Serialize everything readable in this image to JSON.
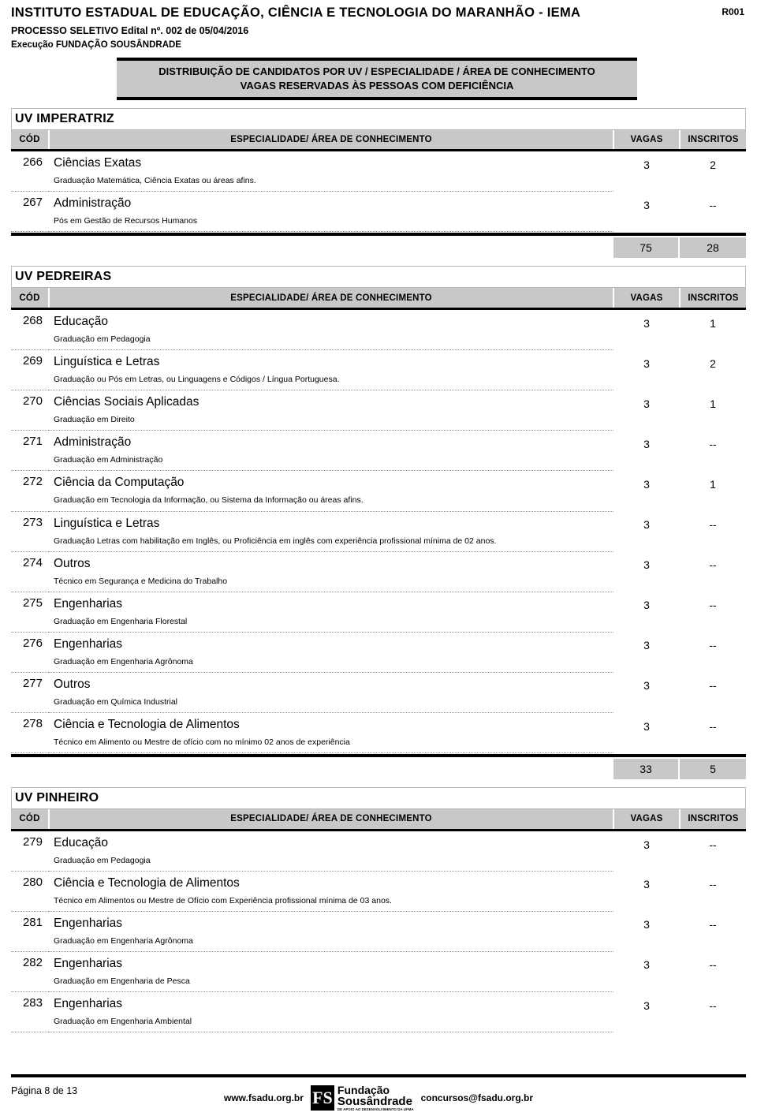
{
  "header": {
    "org_title": "INSTITUTO ESTADUAL DE EDUCAÇÃO, CIÊNCIA E TECNOLOGIA DO MARANHÃO - IEMA",
    "edital_line": "PROCESSO SELETIVO Edital nº. 002 de 05/04/2016",
    "exec_line": "Execução FUNDAÇÃO SOUSÂNDRADE",
    "report_code": "R001"
  },
  "title_box": {
    "line1": "DISTRIBUIÇÃO DE CANDIDATOS POR UV / ESPECIALIDADE / ÁREA DE CONHECIMENTO",
    "line2": "VAGAS RESERVADAS ÀS PESSOAS COM DEFICIÊNCIA"
  },
  "columns": {
    "cod": "CÓD",
    "spec": "ESPECIALIDADE/ ÁREA DE CONHECIMENTO",
    "vagas": "VAGAS",
    "inscritos": "INSCRITOS"
  },
  "groups": [
    {
      "name": "UV IMPERATRIZ",
      "rows": [
        {
          "cod": "266",
          "spec": "Ciências Exatas",
          "desc": "Graduação Matemática, Ciência Exatas ou áreas afins.",
          "vagas": "3",
          "inscritos": "2"
        },
        {
          "cod": "267",
          "spec": "Administração",
          "desc": "Pós em Gestão de Recursos Humanos",
          "vagas": "3",
          "inscritos": "--"
        }
      ],
      "totals": {
        "vagas": "75",
        "inscritos": "28"
      }
    },
    {
      "name": "UV PEDREIRAS",
      "rows": [
        {
          "cod": "268",
          "spec": "Educação",
          "desc": "Graduação em Pedagogia",
          "vagas": "3",
          "inscritos": "1"
        },
        {
          "cod": "269",
          "spec": "Linguística e Letras",
          "desc": "Graduação ou Pós em Letras, ou Linguagens e Códigos / Língua Portuguesa.",
          "vagas": "3",
          "inscritos": "2"
        },
        {
          "cod": "270",
          "spec": "Ciências Sociais Aplicadas",
          "desc": "Graduação em Direito",
          "vagas": "3",
          "inscritos": "1"
        },
        {
          "cod": "271",
          "spec": "Administração",
          "desc": "Graduação em Administração",
          "vagas": "3",
          "inscritos": "--"
        },
        {
          "cod": "272",
          "spec": "Ciência da Computação",
          "desc": "Graduação em Tecnologia da Informação, ou Sistema da Informação ou áreas afins.",
          "vagas": "3",
          "inscritos": "1"
        },
        {
          "cod": "273",
          "spec": "Linguística e Letras",
          "desc": "Graduação Letras com habilitação em Inglês, ou Proficiência em inglês com experiência profissional mínima de 02 anos.",
          "vagas": "3",
          "inscritos": "--"
        },
        {
          "cod": "274",
          "spec": "Outros",
          "desc": "Técnico em Segurança e Medicina do Trabalho",
          "vagas": "3",
          "inscritos": "--"
        },
        {
          "cod": "275",
          "spec": "Engenharias",
          "desc": "Graduação em Engenharia Florestal",
          "vagas": "3",
          "inscritos": "--"
        },
        {
          "cod": "276",
          "spec": "Engenharias",
          "desc": "Graduação em Engenharia Agrônoma",
          "vagas": "3",
          "inscritos": "--"
        },
        {
          "cod": "277",
          "spec": "Outros",
          "desc": "Graduação em Química Industrial",
          "vagas": "3",
          "inscritos": "--"
        },
        {
          "cod": "278",
          "spec": "Ciência e Tecnologia de Alimentos",
          "desc": "Técnico em Alimento ou Mestre de ofício com no mínimo 02 anos de experiência",
          "vagas": "3",
          "inscritos": "--"
        }
      ],
      "totals": {
        "vagas": "33",
        "inscritos": "5"
      }
    },
    {
      "name": "UV PINHEIRO",
      "rows": [
        {
          "cod": "279",
          "spec": "Educação",
          "desc": "Graduação em Pedagogia",
          "vagas": "3",
          "inscritos": "--"
        },
        {
          "cod": "280",
          "spec": "Ciência e Tecnologia de Alimentos",
          "desc": "Técnico em Alimentos ou Mestre de Ofício com Experiência profissional mínima de 03 anos.",
          "vagas": "3",
          "inscritos": "--"
        },
        {
          "cod": "281",
          "spec": "Engenharias",
          "desc": "Graduação em Engenharia Agrônoma",
          "vagas": "3",
          "inscritos": "--"
        },
        {
          "cod": "282",
          "spec": "Engenharias",
          "desc": "Graduação em Engenharia de Pesca",
          "vagas": "3",
          "inscritos": "--"
        },
        {
          "cod": "283",
          "spec": "Engenharias",
          "desc": "Graduação em Engenharia Ambiental",
          "vagas": "3",
          "inscritos": "--"
        }
      ],
      "totals": null
    }
  ],
  "footer": {
    "page_label": "Página 8 de  13",
    "url": "www.fsadu.org.br",
    "email": "concursos@fsadu.org.br",
    "logo_mark": "FS",
    "logo_line1": "Fundação",
    "logo_line2": "Sousândrade",
    "logo_line3": "DE APOIO AO DESENVOLVIMENTO DA UFMA"
  }
}
